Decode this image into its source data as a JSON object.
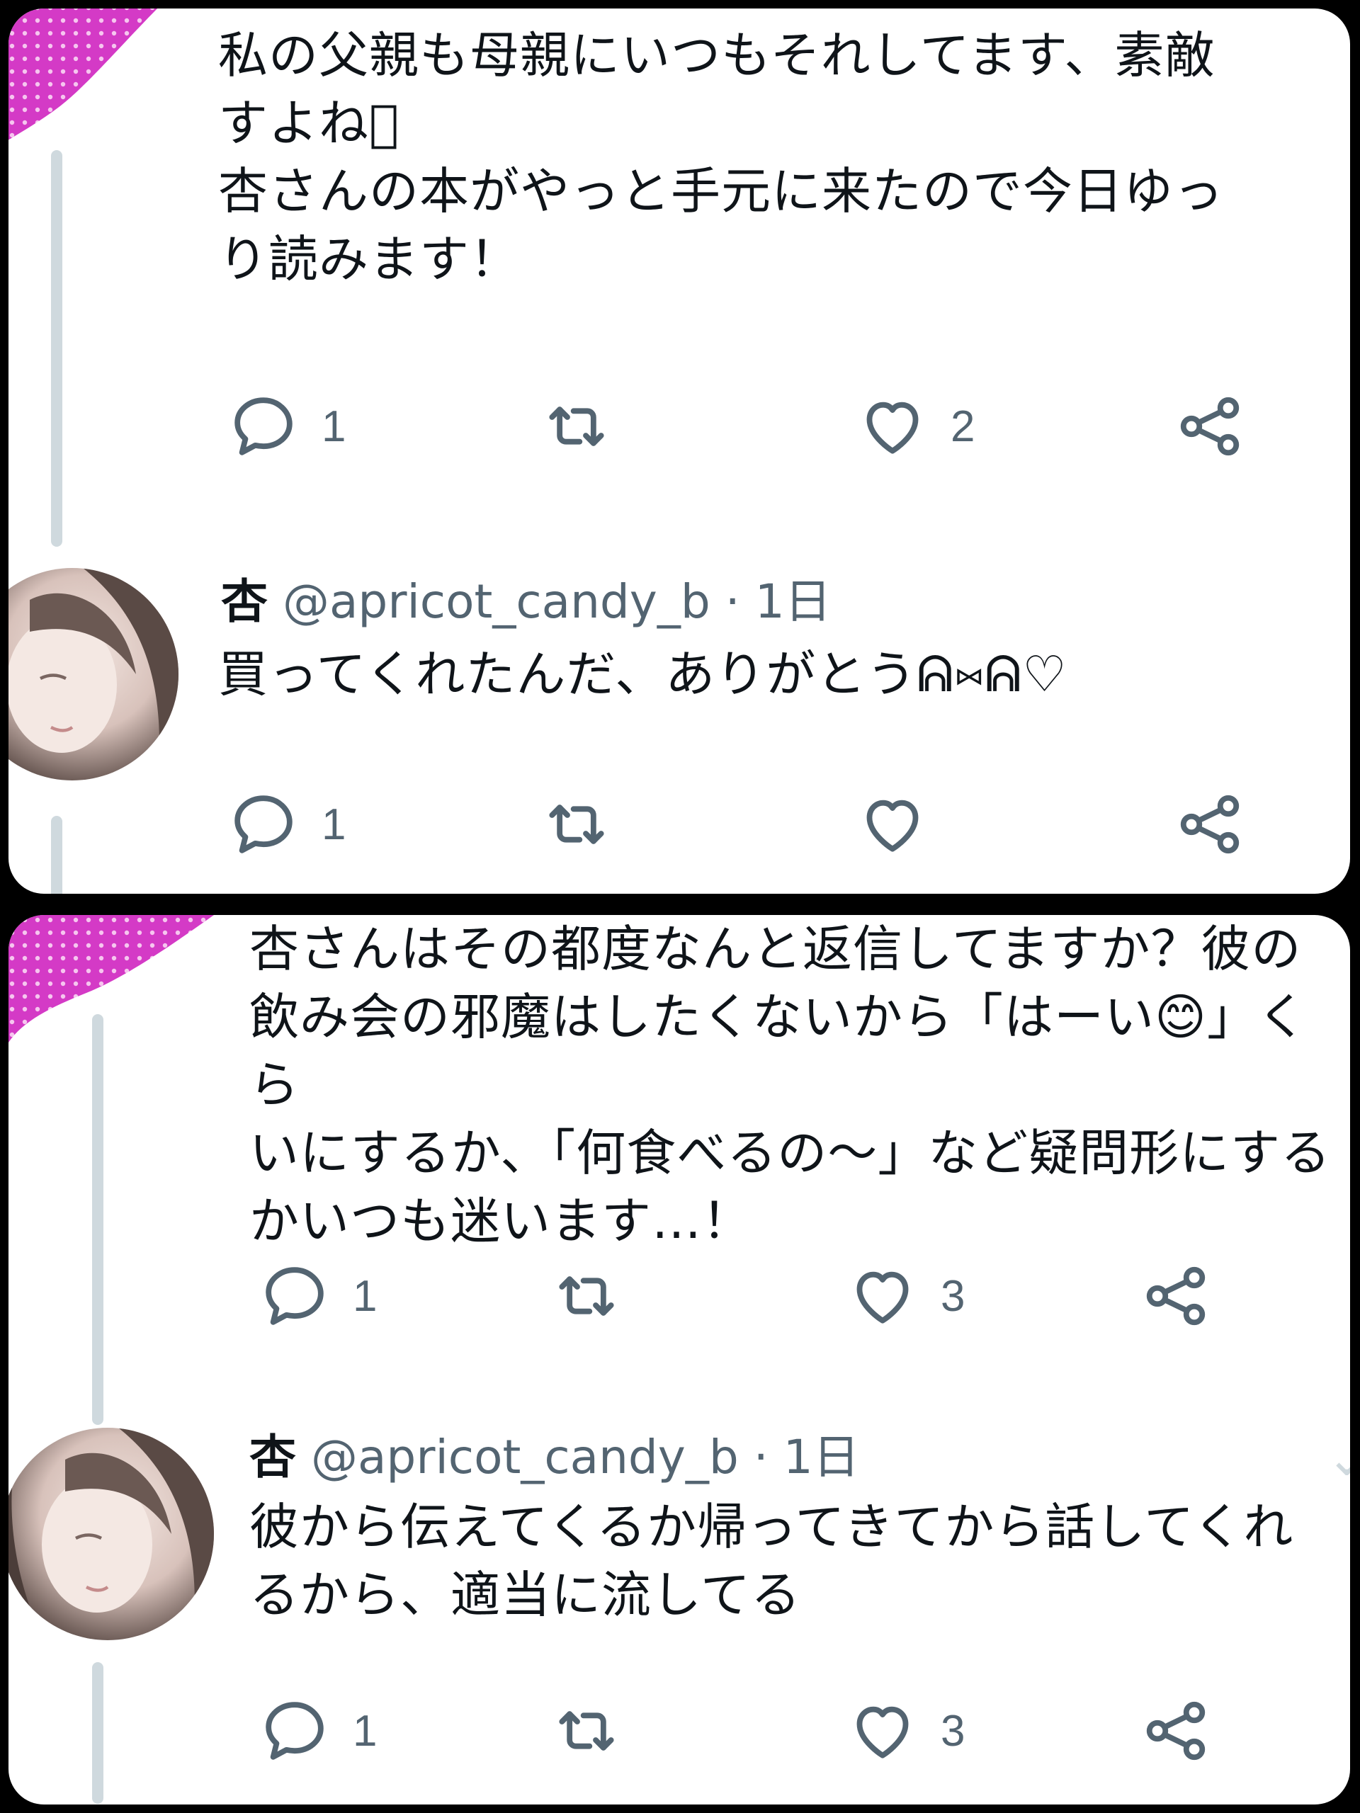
{
  "colors": {
    "accent_pink": "#d43ac6",
    "text": "#0f1419",
    "muted": "#536471",
    "thread": "#cfd9de"
  },
  "panel1": {
    "reply_text": "私の父親も母親にいつもそれしてます、素敵\nすよね\u0000\n杏さんの本がやっと手元に来たので今日ゆっ\nり読みます！",
    "reply_actions": {
      "reply_count": "1",
      "retweet_count": "",
      "like_count": "2"
    },
    "author_reply": {
      "name": "杏",
      "handle": "@apricot_candy_b",
      "time": "· 1日",
      "text": "買ってくれたんだ、ありがとうᕱ⑅ᕱ♡",
      "actions": {
        "reply_count": "1",
        "retweet_count": "",
        "like_count": ""
      }
    }
  },
  "panel2": {
    "reply_text": "杏さんはその都度なんと返信してますか？彼の\n飲み会の邪魔はしたくないから「はーい😊」くら\nいにするか、「何食べるの〜」など疑問形にする\nかいつも迷います…！",
    "reply_actions": {
      "reply_count": "1",
      "retweet_count": "",
      "like_count": "3"
    },
    "author_reply": {
      "name": "杏",
      "handle": "@apricot_candy_b",
      "time": "· 1日",
      "text": "彼から伝えてくるか帰ってきてから話してくれ\nるから、適当に流してる",
      "actions": {
        "reply_count": "1",
        "retweet_count": "",
        "like_count": "3"
      }
    }
  },
  "icons": [
    "reply-icon",
    "retweet-icon",
    "like-icon",
    "share-icon"
  ]
}
